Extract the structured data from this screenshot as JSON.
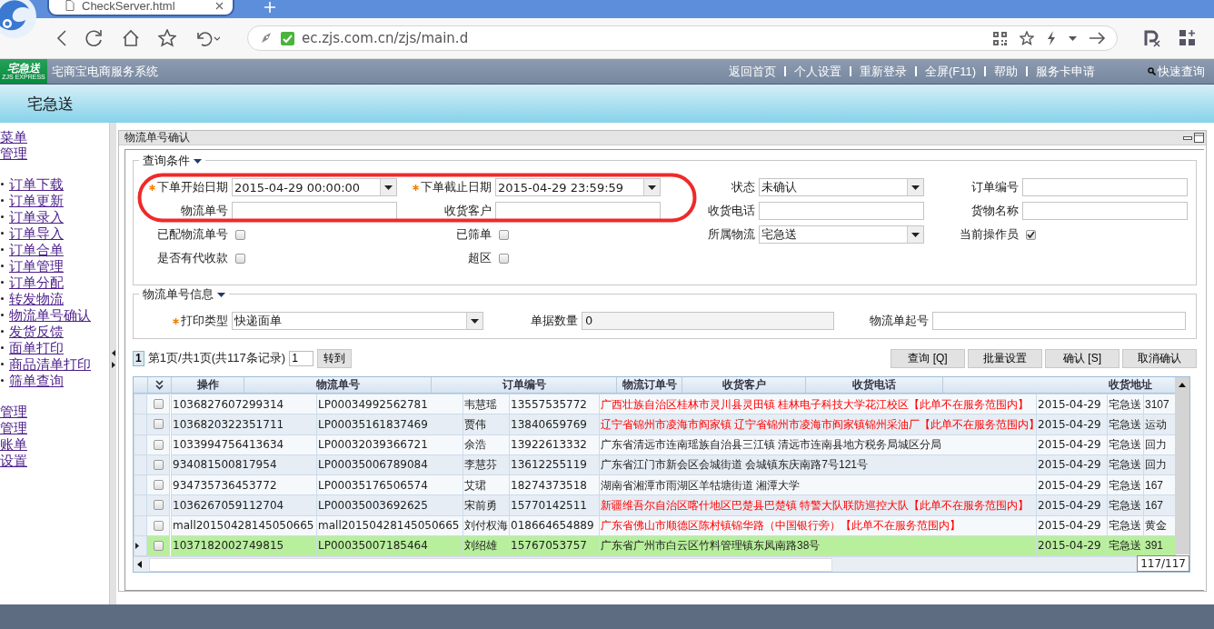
{
  "browser": {
    "tab_title": "CheckServer.html",
    "address": "ec.zjs.com.cn/zjs/main.d"
  },
  "app_header": {
    "logo_text": "宅急送",
    "logo_subtext": "ZJS EXPRESS",
    "system_name": "宅商宝电商服务系统",
    "links": [
      "返回首页",
      "个人设置",
      "重新登录",
      "全屏(F11)",
      "帮助",
      "服务卡申请"
    ],
    "quick_search": "快速查询"
  },
  "banner": {
    "title": "宅急送"
  },
  "sidebar": {
    "items": [
      {
        "label": "菜单",
        "kind": "heading"
      },
      {
        "label": "管理",
        "kind": "heading"
      },
      {
        "label": "订单下载",
        "kind": "link"
      },
      {
        "label": "订单更新",
        "kind": "link"
      },
      {
        "label": "订单录入",
        "kind": "link"
      },
      {
        "label": "订单导入",
        "kind": "link"
      },
      {
        "label": "订单合单",
        "kind": "link"
      },
      {
        "label": "订单管理",
        "kind": "link"
      },
      {
        "label": "订单分配",
        "kind": "link"
      },
      {
        "label": "转发物流",
        "kind": "link"
      },
      {
        "label": "物流单号确认",
        "kind": "link"
      },
      {
        "label": "发货反馈",
        "kind": "link"
      },
      {
        "label": "面单打印",
        "kind": "link"
      },
      {
        "label": "商品清单打印",
        "kind": "link"
      },
      {
        "label": "筛单查询",
        "kind": "link"
      },
      {
        "label": "管理",
        "kind": "heading"
      },
      {
        "label": "管理",
        "kind": "heading"
      },
      {
        "label": "账单",
        "kind": "heading"
      },
      {
        "label": "设置",
        "kind": "heading"
      }
    ]
  },
  "panel": {
    "title": "物流单号确认",
    "search": {
      "title": "查询条件",
      "fields": [
        {
          "label": "下单开始日期",
          "kind": "select",
          "required": true,
          "value": "2015-04-29 00:00:00"
        },
        {
          "label": "下单截止日期",
          "kind": "select",
          "required": true,
          "value": "2015-04-29 23:59:59"
        },
        {
          "label": "状态",
          "kind": "select",
          "required": false,
          "value": "未确认"
        },
        {
          "label": "订单编号",
          "kind": "text",
          "required": false
        },
        {
          "label": "物流单号",
          "kind": "text",
          "required": false
        },
        {
          "label": "收货客户",
          "kind": "text",
          "required": false
        },
        {
          "label": "收货电话",
          "kind": "text",
          "required": false
        },
        {
          "label": "货物名称",
          "kind": "text",
          "required": false
        },
        {
          "label": "已配物流单号",
          "kind": "checkbox",
          "required": false,
          "checked": false
        },
        {
          "label": "已筛单",
          "kind": "checkbox",
          "required": false,
          "checked": false
        },
        {
          "label": "所属物流",
          "kind": "select",
          "required": false,
          "value": "宅急送"
        },
        {
          "label": "当前操作员",
          "kind": "checkbox",
          "required": false,
          "checked": true
        },
        {
          "label": "是否有代收款",
          "kind": "checkbox",
          "required": false,
          "checked": false
        },
        {
          "label": "超区",
          "kind": "checkbox",
          "required": false,
          "checked": false
        }
      ]
    },
    "print": {
      "title": "物流单号信息",
      "fields": [
        {
          "label": "打印类型",
          "kind": "select",
          "required": true,
          "value": "快递面单"
        },
        {
          "label": "单据数量",
          "kind": "readonly",
          "required": false,
          "value": "0"
        },
        {
          "label": "物流单起号",
          "kind": "text",
          "required": false
        }
      ]
    },
    "pager": {
      "page_button": "1",
      "summary": "第1页/共1页(共117条记录)",
      "page_input": "1",
      "go_button": "转到"
    },
    "actions": [
      "查询 [Q]",
      "批量设置",
      "确认 [S]",
      "取消确认"
    ],
    "grid": {
      "header": [
        "操作",
        "物流单号",
        "订单编号",
        "物流订单号",
        "收货客户",
        "收货电话",
        "收货地址"
      ],
      "rows": [
        {
          "selected": false,
          "checked": false,
          "out_of_range": true,
          "cells": [
            "1036827607299314",
            "LP00034992562781",
            "韦慧瑶",
            "13557535772",
            "广西壮族自治区桂林市灵川县灵田镇 桂林电子科技大学花江校区【此单不在服务范围内】",
            "2015-04-29",
            "宅急送",
            "3107"
          ]
        },
        {
          "selected": false,
          "checked": false,
          "out_of_range": true,
          "cells": [
            "1036820322351711",
            "LP00035161837469",
            "贾伟",
            "13840659769",
            "辽宁省锦州市凌海市阎家镇 辽宁省锦州市凌海市阎家镇锦州采油厂【此单不在服务范围内】",
            "2015-04-29",
            "宅急送",
            "运动"
          ]
        },
        {
          "selected": false,
          "checked": false,
          "out_of_range": false,
          "cells": [
            "1033994756413634",
            "LP00032039366721",
            "余浩",
            "13922613332",
            "广东省清远市连南瑶族自治县三江镇 清远市连南县地方税务局城区分局",
            "2015-04-29",
            "宅急送",
            "回力"
          ]
        },
        {
          "selected": false,
          "checked": false,
          "out_of_range": false,
          "cells": [
            "934081500817954",
            "LP00035006789084",
            "李慧芬",
            "13612255119",
            "广东省江门市新会区会城街道 会城镇东庆南路7号121号",
            "2015-04-29",
            "宅急送",
            "回力"
          ]
        },
        {
          "selected": false,
          "checked": false,
          "out_of_range": false,
          "cells": [
            "934735736453772",
            "LP00035176506574",
            "艾珺",
            "18274373518",
            "湖南省湘潭市雨湖区羊牯塘街道 湘潭大学",
            "2015-04-29",
            "宅急送",
            "167"
          ]
        },
        {
          "selected": false,
          "checked": false,
          "out_of_range": true,
          "cells": [
            "1036267059112704",
            "LP00035003692625",
            "宋前勇",
            "15770142511",
            "新疆维吾尔自治区喀什地区巴楚县巴楚镇 特警大队联防巡控大队【此单不在服务范围内】",
            "2015-04-29",
            "宅急送",
            "167"
          ]
        },
        {
          "selected": false,
          "checked": false,
          "out_of_range": true,
          "cells": [
            "mall20150428145050665",
            "mall20150428145050665",
            "刘付权海",
            "018664654889",
            "广东省佛山市顺德区陈村镇锦华路（中国银行旁）【此单不在服务范围内】",
            "2015-04-29",
            "宅急送",
            "黄金"
          ]
        },
        {
          "selected": true,
          "checked": false,
          "out_of_range": false,
          "cells": [
            "1037182002749815",
            "LP00035007185464",
            "刘绍雄",
            "15767053757",
            "广东省广州市白云区竹料管理镇东凤南路38号",
            "2015-04-29",
            "宅急送",
            "391"
          ]
        }
      ]
    },
    "tooltip": "117/117"
  }
}
